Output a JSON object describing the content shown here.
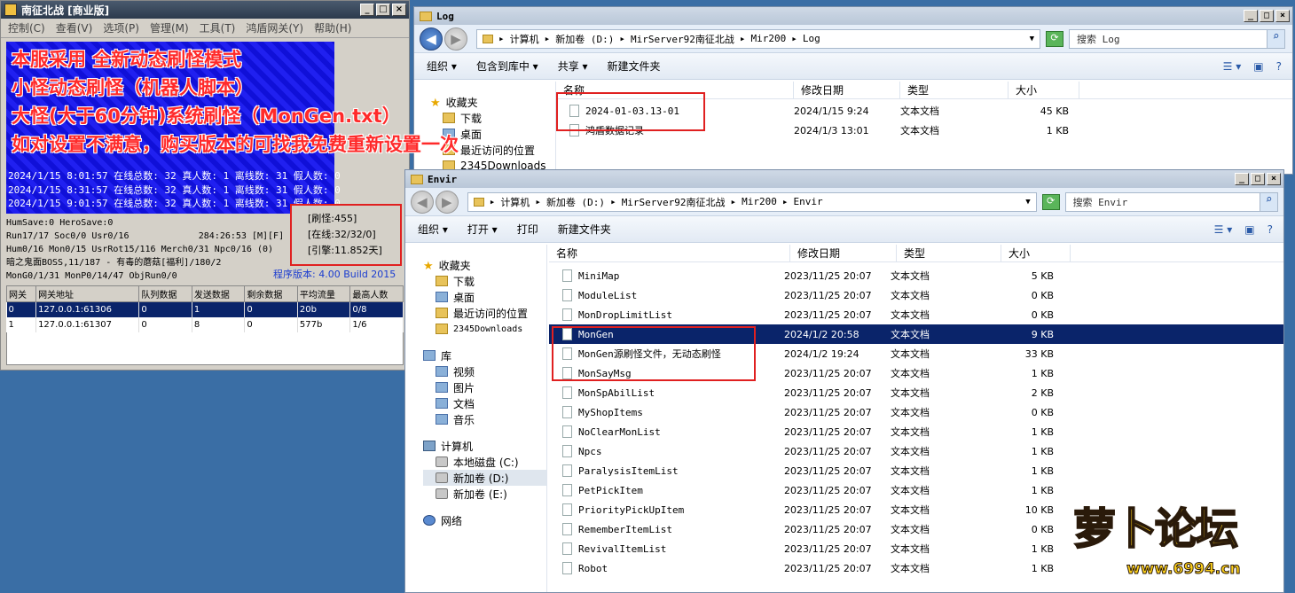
{
  "server": {
    "title": "南征北战 [商业版]",
    "menu": [
      "控制(C)",
      "查看(V)",
      "选项(P)",
      "管理(M)",
      "工具(T)",
      "鸿盾网关(Y)",
      "帮助(H)"
    ],
    "promo": [
      "本服采用 全新动态刷怪模式",
      "小怪动态刷怪（机器人脚本）",
      "大怪(大于60分钟)系统刷怪（MonGen.txt）",
      "如对设置不满意，购买版本的可找我免费重新设置一次"
    ],
    "log": [
      "2024/1/15 8:01:57 在线总数: 32 真人数: 1 离线数: 31 假人数: 0",
      "2024/1/15 8:31:57 在线总数: 32 真人数: 1 离线数: 31 假人数: 0",
      "2024/1/15 9:01:57 在线总数: 32 真人数: 1 离线数: 31 假人数: 0"
    ],
    "status": [
      "HumSave:0 HeroSave:0",
      "Run17/17 Soc0/0 Usr0/16",
      "Hum0/16 Mon0/15 UsrRot15/116 Merch0/31 Npc0/16 (0)",
      "暗之鬼面BOSS,11/187 - 有毒的蘑菇[福利]/180/2",
      "MonG0/1/31 MonP0/14/47 ObjRun0/0"
    ],
    "timer": "284:26:53 [M][F]",
    "stats": [
      "[刷怪:455]",
      "[在线:32/32/0]",
      "[引擎:11.852天]"
    ],
    "version": "程序版本: 4.00 Build 2015",
    "table": {
      "headers": [
        "网关",
        "网关地址",
        "队列数据",
        "发送数据",
        "剩余数据",
        "平均流量",
        "最高人数"
      ],
      "rows": [
        [
          "0",
          "127.0.0.1:61306",
          "0",
          "1",
          "0",
          "20b",
          "0/8"
        ],
        [
          "1",
          "127.0.0.1:61307",
          "0",
          "8",
          "0",
          "577b",
          "1/6"
        ]
      ]
    }
  },
  "log_window": {
    "title": "Log",
    "path": [
      "计算机",
      "新加卷 (D:)",
      "MirServer92南征北战",
      "Mir200",
      "Log"
    ],
    "search": "搜索 Log",
    "toolbar": [
      "组织 ▾",
      "包含到库中 ▾",
      "共享 ▾",
      "新建文件夹"
    ],
    "nav": [
      "收藏夹",
      "下载",
      "桌面",
      "最近访问的位置",
      "2345Downloads"
    ],
    "columns": [
      "名称",
      "修改日期",
      "类型",
      "大小"
    ],
    "files": [
      {
        "name": "2024-01-03.13-01",
        "date": "2024/1/15 9:24",
        "type": "文本文档",
        "size": "45 KB"
      },
      {
        "name": "鸿盾数据记录",
        "date": "2024/1/3 13:01",
        "type": "文本文档",
        "size": "1 KB"
      }
    ]
  },
  "envir_window": {
    "title": "Envir",
    "path": [
      "计算机",
      "新加卷 (D:)",
      "MirServer92南征北战",
      "Mir200",
      "Envir"
    ],
    "search": "搜索 Envir",
    "toolbar": [
      "组织 ▾",
      "打开 ▾",
      "打印",
      "新建文件夹"
    ],
    "nav": [
      "收藏夹",
      "下载",
      "桌面",
      "最近访问的位置",
      "2345Downloads",
      "库",
      "视频",
      "图片",
      "文档",
      "音乐",
      "计算机",
      "本地磁盘 (C:)",
      "新加卷 (D:)",
      "新加卷 (E:)",
      "网络"
    ],
    "columns": [
      "名称",
      "修改日期",
      "类型",
      "大小"
    ],
    "files": [
      {
        "name": "MiniMap",
        "date": "2023/11/25 20:07",
        "type": "文本文档",
        "size": "5 KB"
      },
      {
        "name": "ModuleList",
        "date": "2023/11/25 20:07",
        "type": "文本文档",
        "size": "0 KB"
      },
      {
        "name": "MonDropLimitList",
        "date": "2023/11/25 20:07",
        "type": "文本文档",
        "size": "0 KB"
      },
      {
        "name": "MonGen",
        "date": "2024/1/2 20:58",
        "type": "文本文档",
        "size": "9 KB"
      },
      {
        "name": "MonGen源刷怪文件，无动态刷怪",
        "date": "2024/1/2 19:24",
        "type": "文本文档",
        "size": "33 KB"
      },
      {
        "name": "MonSayMsg",
        "date": "2023/11/25 20:07",
        "type": "文本文档",
        "size": "1 KB"
      },
      {
        "name": "MonSpAbilList",
        "date": "2023/11/25 20:07",
        "type": "文本文档",
        "size": "2 KB"
      },
      {
        "name": "MyShopItems",
        "date": "2023/11/25 20:07",
        "type": "文本文档",
        "size": "0 KB"
      },
      {
        "name": "NoClearMonList",
        "date": "2023/11/25 20:07",
        "type": "文本文档",
        "size": "1 KB"
      },
      {
        "name": "Npcs",
        "date": "2023/11/25 20:07",
        "type": "文本文档",
        "size": "1 KB"
      },
      {
        "name": "ParalysisItemList",
        "date": "2023/11/25 20:07",
        "type": "文本文档",
        "size": "1 KB"
      },
      {
        "name": "PetPickItem",
        "date": "2023/11/25 20:07",
        "type": "文本文档",
        "size": "1 KB"
      },
      {
        "name": "PriorityPickUpItem",
        "date": "2023/11/25 20:07",
        "type": "文本文档",
        "size": "10 KB"
      },
      {
        "name": "RememberItemList",
        "date": "2023/11/25 20:07",
        "type": "文本文档",
        "size": "0 KB"
      },
      {
        "name": "RevivalItemList",
        "date": "2023/11/25 20:07",
        "type": "文本文档",
        "size": "1 KB"
      },
      {
        "name": "Robot",
        "date": "2023/11/25 20:07",
        "type": "文本文档",
        "size": "1 KB"
      }
    ]
  },
  "watermark": {
    "logo": "萝卜论坛",
    "site": "www.6994.cn"
  },
  "colors": {
    "promo_red": "#ff2a2a",
    "highlight_box": "#e02020",
    "selection": "#0a246a"
  }
}
